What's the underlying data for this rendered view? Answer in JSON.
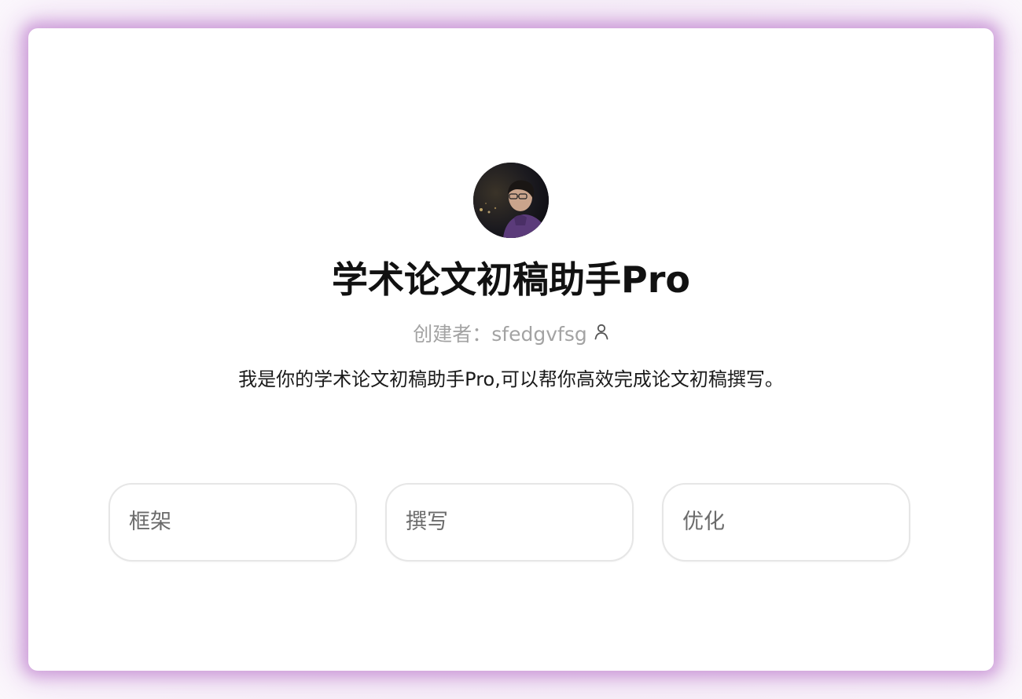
{
  "bot": {
    "title": "学术论文初稿助手Pro",
    "creator_label": "创建者：",
    "creator_name": "sfedgvfsg",
    "description": "我是你的学术论文初稿助手Pro,可以帮你高效完成论文初稿撰写。",
    "avatar_icon": "avatar-photo"
  },
  "suggestions": [
    {
      "label": "框架"
    },
    {
      "label": "撰写"
    },
    {
      "label": "优化"
    }
  ],
  "colors": {
    "frame_glow": "#c48cd2",
    "title": "#111111",
    "creator_text": "#a3a3a3",
    "chip_border": "#e6e6e6",
    "chip_text": "#6b6b6b"
  }
}
